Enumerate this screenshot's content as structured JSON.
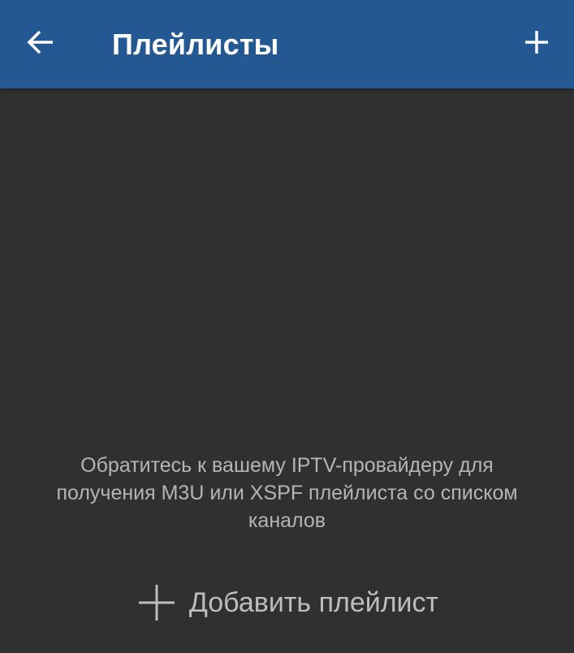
{
  "appbar": {
    "title": "Плейлисты",
    "back_icon": "arrow-left-icon",
    "add_icon": "plus-icon",
    "background_color": "#245893"
  },
  "empty_state": {
    "message": "Обратитесь к вашему IPTV-провайдеру для получения M3U или XSPF плейлиста со списком каналов",
    "add_label": "Добавить плейлист",
    "add_icon": "plus-icon"
  },
  "colors": {
    "background": "#303030",
    "text_muted": "#b5b5b5",
    "text_on_primary": "#ffffff"
  }
}
